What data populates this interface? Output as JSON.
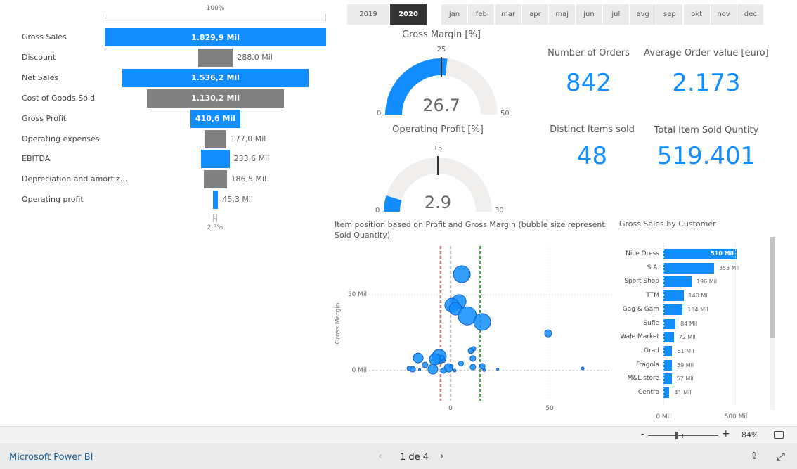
{
  "funnel": {
    "top_percent": "100%",
    "bottom_percent": "2,5%",
    "rows": [
      {
        "label": "Gross Sales",
        "value": 1829.9,
        "text": "1.829,9 Mil",
        "color": "#118dff"
      },
      {
        "label": "Discount",
        "value": 288.0,
        "text": "288,0 Mil",
        "color": "#808080"
      },
      {
        "label": "Net Sales",
        "value": 1536.2,
        "text": "1.536,2 Mil",
        "color": "#118dff"
      },
      {
        "label": "Cost of Goods Sold",
        "value": 1130.2,
        "text": "1.130,2 Mil",
        "color": "#808080"
      },
      {
        "label": "Gross Profit",
        "value": 410.6,
        "text": "410,6 Mil",
        "color": "#118dff"
      },
      {
        "label": "Operating expenses",
        "value": 177.0,
        "text": "177,0 Mil",
        "color": "#808080"
      },
      {
        "label": "EBITDA",
        "value": 233.6,
        "text": "233,6 Mil",
        "color": "#118dff"
      },
      {
        "label": "Depreciation and amortiz...",
        "value": 186.5,
        "text": "186,5 Mil",
        "color": "#808080"
      },
      {
        "label": "Operating profit",
        "value": 45.3,
        "text": "45,3 Mil",
        "color": "#118dff"
      }
    ]
  },
  "slicers": {
    "years": [
      {
        "label": "2019",
        "selected": false
      },
      {
        "label": "2020",
        "selected": true
      }
    ],
    "months": [
      "jan",
      "feb",
      "mar",
      "apr",
      "maj",
      "jun",
      "jul",
      "avg",
      "sep",
      "okt",
      "nov",
      "dec"
    ]
  },
  "gauges": [
    {
      "title": "Gross Margin [%]",
      "value": 26.7,
      "value_text": "26.7",
      "min": 0,
      "max": 50,
      "target": 25,
      "min_text": "0",
      "max_text": "50",
      "target_text": "25"
    },
    {
      "title": "Operating Profit [%]",
      "value": 2.9,
      "value_text": "2.9",
      "min": 0,
      "max": 30,
      "target": 15,
      "min_text": "0",
      "max_text": "30",
      "target_text": "15"
    }
  ],
  "kpis": [
    {
      "title": "Number of Orders",
      "value": "842"
    },
    {
      "title": "Average Order value [euro]",
      "value": "2.173"
    },
    {
      "title": "Distinct Items sold",
      "value": "48"
    },
    {
      "title": "Total Item Sold Quntity",
      "value": "519.401"
    }
  ],
  "chart_data": [
    {
      "type": "scatter",
      "title": "Item position based on Profit and Gross Margin (bubble size represent Sold Quantity)",
      "ylabel": "Gross Margin",
      "xlabel": "",
      "x_ticks": [
        "0",
        "50"
      ],
      "y_ticks": [
        "0 Mil",
        "50 Mil"
      ],
      "xlim": [
        -40,
        75
      ],
      "ylim": [
        -20,
        80
      ],
      "reference_lines": [
        {
          "x": -5,
          "color": "#c97b7b"
        },
        {
          "x": 15,
          "color": "#4a9a4a"
        },
        {
          "x": 0,
          "color": "#c8c8c8"
        }
      ],
      "points": [
        {
          "x": 5.7,
          "y": 63.4,
          "size": 12
        },
        {
          "x": 4.3,
          "y": 45.4,
          "size": 10
        },
        {
          "x": 0.7,
          "y": 43,
          "size": 10
        },
        {
          "x": 2.5,
          "y": 40.7,
          "size": 9
        },
        {
          "x": 8.5,
          "y": 36,
          "size": 13
        },
        {
          "x": 16,
          "y": 32,
          "size": 12
        },
        {
          "x": 49.3,
          "y": 24.5,
          "size": 5
        },
        {
          "x": -5.7,
          "y": 9.3,
          "size": 10
        },
        {
          "x": -7.8,
          "y": 7.4,
          "size": 8
        },
        {
          "x": -4.3,
          "y": 8.3,
          "size": 3.5
        },
        {
          "x": -16.3,
          "y": 8.3,
          "size": 7
        },
        {
          "x": -8.9,
          "y": 0.9,
          "size": 7
        },
        {
          "x": -1,
          "y": 1.8,
          "size": 6
        },
        {
          "x": 10.3,
          "y": 13,
          "size": 4
        },
        {
          "x": 11.7,
          "y": 14.4,
          "size": 3
        },
        {
          "x": 11.3,
          "y": 7.9,
          "size": 4
        },
        {
          "x": 11.3,
          "y": 2.3,
          "size": 4
        },
        {
          "x": 16,
          "y": 2.8,
          "size": 4
        },
        {
          "x": 5.3,
          "y": 4.6,
          "size": 3.5
        },
        {
          "x": -20.9,
          "y": 1.4,
          "size": 3
        },
        {
          "x": -19.1,
          "y": 0.9,
          "size": 4
        },
        {
          "x": -12.8,
          "y": 3.7,
          "size": 4
        },
        {
          "x": -3.5,
          "y": 0,
          "size": 4
        },
        {
          "x": -3.5,
          "y": 6.5,
          "size": 2.5
        },
        {
          "x": 0.4,
          "y": 2.8,
          "size": 2.5
        },
        {
          "x": 2.1,
          "y": 0,
          "size": 2
        },
        {
          "x": 17,
          "y": 0.3,
          "size": 2
        },
        {
          "x": 23.8,
          "y": 0.9,
          "size": 1.5
        },
        {
          "x": 66.7,
          "y": 1.4,
          "size": 2
        },
        {
          "x": -15.6,
          "y": 0.5,
          "size": 1.5
        }
      ]
    },
    {
      "type": "bar",
      "orientation": "horizontal",
      "title": "Gross Sales by Customer",
      "x_ticks": [
        "0 Mil",
        "500 Mil"
      ],
      "xlim": [
        0,
        530
      ],
      "categories": [
        "Nice Dress",
        "S.A.",
        "Sport Shop",
        "TTM",
        "Gag & Gam",
        "Sufle",
        "Wale Market",
        "Grad",
        "Fragola",
        "M&L store",
        "Centro"
      ],
      "values": [
        510,
        353,
        196,
        140,
        134,
        84,
        72,
        61,
        59,
        57,
        41
      ],
      "labels": [
        "510 Mil",
        "353 Mil",
        "196 Mil",
        "140 Mil",
        "134 Mil",
        "84 Mil",
        "72 Mil",
        "61 Mil",
        "59 Mil",
        "57 Mil",
        "41 Mil"
      ],
      "color": "#118dff"
    }
  ],
  "toolbar": {
    "zoom_minus": "-",
    "zoom_plus": "+",
    "zoom_level": "84%",
    "zoom_fraction": 0.55
  },
  "footer": {
    "brand": "Microsoft Power BI",
    "page": "1 de 4"
  }
}
